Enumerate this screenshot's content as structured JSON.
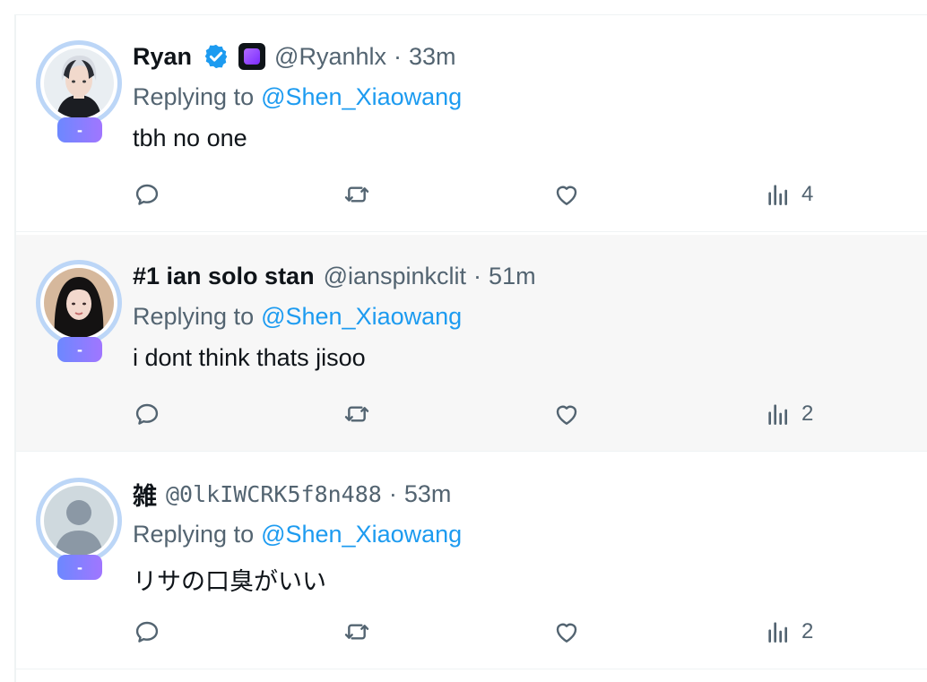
{
  "replies": [
    {
      "name": "Ryan",
      "handle": "@Ryanhlx",
      "time": "33m",
      "replying_label": "Replying to",
      "replying_to": "@Shen_Xiaowang",
      "text": "tbh no one",
      "views": "4",
      "pill": "-",
      "badges": [
        "verified-badge-icon",
        "app-badge-icon"
      ]
    },
    {
      "name": "#1 ian solo stan",
      "handle": "@ianspinkclit",
      "time": "51m",
      "replying_label": "Replying to",
      "replying_to": "@Shen_Xiaowang",
      "text": "i dont think thats jisoo",
      "views": "2",
      "pill": "-"
    },
    {
      "name": "雑",
      "handle": "@0lkIWCRK5f8n488",
      "time": "53m",
      "replying_label": "Replying to",
      "replying_to": "@Shen_Xiaowang",
      "text": "リサの口臭がいい",
      "views": "2",
      "pill": "-"
    }
  ],
  "separator": "·",
  "colors": {
    "link": "#1d9bf0",
    "muted": "#536471",
    "text": "#0f1419",
    "highlight_row_bg": "#f7f7f7",
    "pill_gradient_start": "#6c88ff",
    "pill_gradient_end": "#a176ff",
    "avatar_ring": "#bcd6f7"
  },
  "icons": {
    "reply": "reply-icon",
    "repost": "repost-icon",
    "like": "like-icon",
    "views": "views-icon"
  }
}
